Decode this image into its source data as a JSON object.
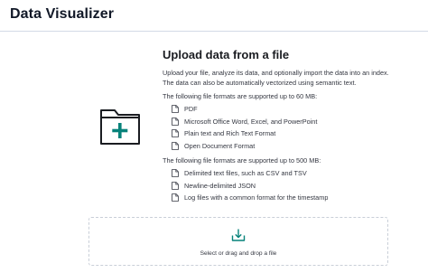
{
  "header": {
    "title": "Data Visualizer"
  },
  "upload": {
    "title": "Upload data from a file",
    "description_line1": "Upload your file, analyze its data, and optionally import the data into an index.",
    "description_line2": "The data can also be automatically vectorized using semantic text.",
    "section_60mb": {
      "lead": "The following file formats are supported up to 60 MB:",
      "items": [
        "PDF",
        "Microsoft Office Word, Excel, and PowerPoint",
        "Plain text and Rich Text Format",
        "Open Document Format"
      ]
    },
    "section_500mb": {
      "lead": "The following file formats are supported up to 500 MB:",
      "items": [
        "Delimited text files, such as CSV and TSV",
        "Newline-delimited JSON",
        "Log files with a common format for the timestamp"
      ]
    }
  },
  "dropzone": {
    "label": "Select or drag and drop a file",
    "icon": "upload-icon"
  },
  "colors": {
    "accent": "#07827a",
    "text": "#343741",
    "border": "#d3dae6"
  }
}
